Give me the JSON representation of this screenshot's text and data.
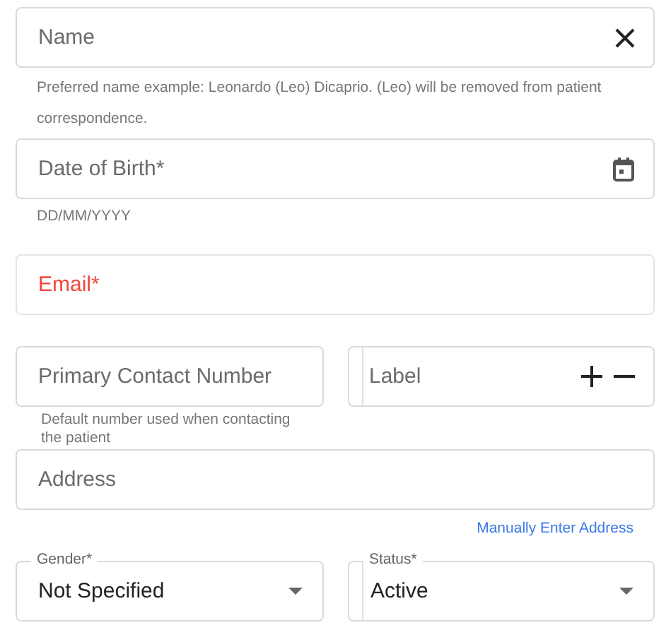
{
  "name_field": {
    "placeholder": "Name",
    "clearable": true,
    "helper": "Preferred name example: Leonardo (Leo) Dicaprio. (Leo) will be removed from patient correspondence."
  },
  "dob_field": {
    "placeholder": "Date of Birth*",
    "helper": "DD/MM/YYYY"
  },
  "email_field": {
    "placeholder": "Email*",
    "error": true
  },
  "contact": {
    "number": {
      "placeholder": "Primary Contact Number",
      "helper": "Default number used when contacting the patient"
    },
    "label": {
      "placeholder": "Label"
    }
  },
  "address": {
    "placeholder": "Address",
    "link": "Manually Enter Address"
  },
  "selects": [
    {
      "label": "Gender*",
      "value": "Not Specified",
      "divided": false
    },
    {
      "label": "Status*",
      "value": "Active",
      "divided": true
    }
  ]
}
